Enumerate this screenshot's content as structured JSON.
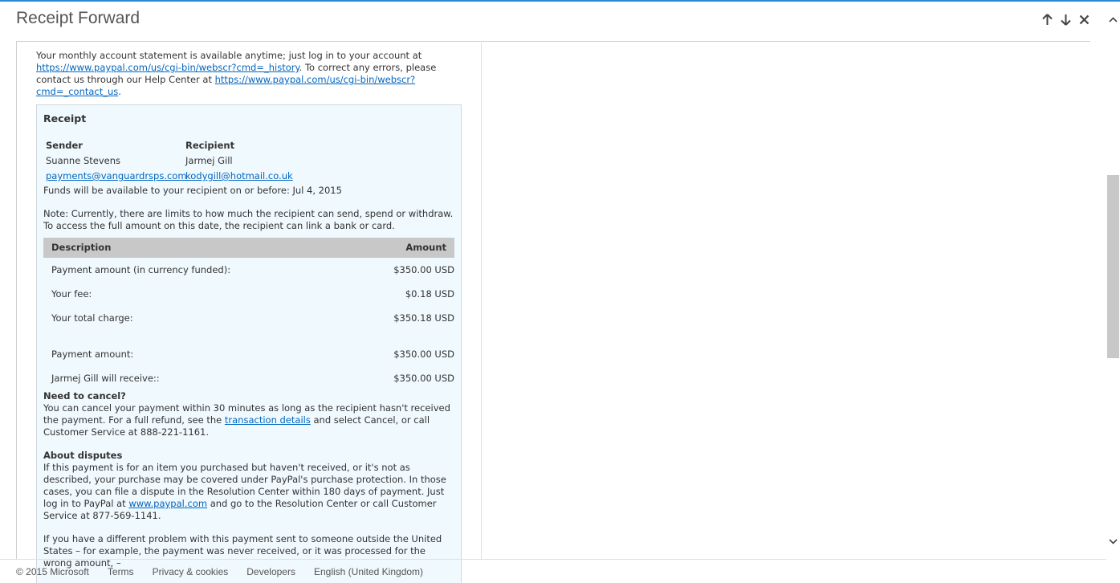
{
  "window": {
    "title": "Receipt Forward",
    "prev_icon": "arrow-up-icon",
    "next_icon": "arrow-down-icon",
    "close_icon": "close-icon"
  },
  "message": {
    "intro_text1": "Your monthly account statement is available anytime; just log in to your account at ",
    "intro_link1": "https://www.paypal.com/us/cgi-bin/webscr?cmd=_history",
    "intro_text2": ". To correct any errors, please contact us through our Help Center at ",
    "intro_link2": "https://www.paypal.com/us/cgi-bin/webscr?cmd=_contact_us",
    "intro_text3": ".",
    "receipt": {
      "title": "Receipt",
      "sender_label": "Sender",
      "recipient_label": "Recipient",
      "sender_name": "Suanne Stevens",
      "recipient_name": "Jarmej Gill",
      "sender_email": "payments@vanguardrsps.com",
      "recipient_email": "kodygill@hotmail.co.uk",
      "funds_text": "Funds will be available to your recipient on or before: Jul 4, 2015",
      "note_text": "Note: Currently, there are limits to how much the recipient can send, spend or withdraw. To access the full amount on this date, the recipient can link a bank or card.",
      "table": {
        "col_description": "Description",
        "col_amount": "Amount",
        "rows": [
          {
            "label": "Payment amount (in currency funded):",
            "amount": "$350.00 USD"
          },
          {
            "label": "Your fee:",
            "amount": "$0.18 USD"
          },
          {
            "label": "Your total charge:",
            "amount": "$350.18 USD"
          },
          {
            "label": "Payment amount:",
            "amount": "$350.00 USD"
          },
          {
            "label": "Jarmej Gill will receive::",
            "amount": "$350.00 USD"
          }
        ]
      },
      "cancel_heading": "Need to cancel?",
      "cancel_text1": "You can cancel your payment within 30 minutes as long as the recipient hasn't received the payment. For a full refund, see the ",
      "cancel_link": "transaction details",
      "cancel_text2": " and select Cancel, or call Customer Service at 888-221-1161.",
      "disputes_heading": "About disputes",
      "disputes_text1": "If this payment is for an item you purchased but haven't received, or it's not as described, your purchase may be covered under PayPal's purchase protection. In those cases, you can file a dispute in the Resolution Center within 180 days of payment. Just log in to PayPal at ",
      "disputes_link": "www.paypal.com",
      "disputes_text2": " and go to the Resolution Center or call Customer Service at 877-569-1141.",
      "different_text": "If you have a different problem with this payment sent to someone outside the United States – for example, the payment was never received, or it was processed for the wrong amount, –"
    }
  },
  "footer": {
    "copyright": "© 2015 Microsoft",
    "terms": "Terms",
    "privacy": "Privacy & cookies",
    "developers": "Developers",
    "language": "English (United Kingdom)"
  },
  "colors": {
    "accent": "#2b88d8",
    "link": "#0066c0",
    "receipt_bg": "#f0f9fd",
    "table_header_bg": "#c8c8c8"
  }
}
